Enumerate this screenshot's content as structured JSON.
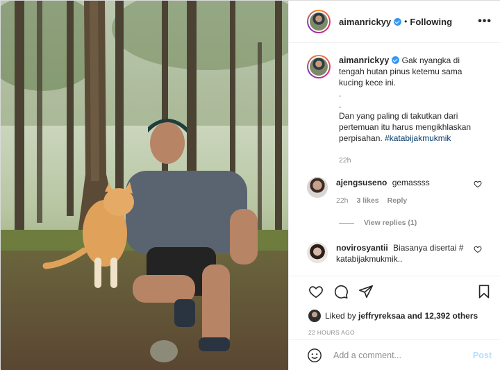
{
  "post": {
    "username": "aimanrickyy",
    "separator": "•",
    "follow_status": "Following",
    "more_label": "•••"
  },
  "caption": {
    "username": "aimanrickyy",
    "lines": [
      "Gak nyangka di",
      "tengah hutan pinus ketemu sama",
      "kucing kece ini.",
      ".",
      ".",
      "Dan yang paling di takutkan dari",
      "pertemuan itu harus mengikhlaskan",
      "perpisahan."
    ],
    "hashtag": "#katabijakmukmik",
    "time": "22h"
  },
  "comments": [
    {
      "username": "ajengsuseno",
      "text": "gemassss",
      "time": "22h",
      "likes": "3 likes",
      "reply": "Reply",
      "view_replies": "View replies (1)"
    },
    {
      "username": "novirosyantii",
      "text": "Biasanya disertai # katabijakmukmik.."
    }
  ],
  "likes": {
    "prefix": "Liked by",
    "user": "jeffryreksaa",
    "suffix": "and 12,392 others"
  },
  "timestamp": "22 HOURS AGO",
  "add_comment": {
    "placeholder": "Add a comment...",
    "post_label": "Post"
  },
  "icons": [
    "more-icon",
    "verified-icon",
    "heart-icon",
    "comment-icon",
    "share-icon",
    "bookmark-icon",
    "emoji-icon"
  ],
  "colors": {
    "verified": "#3897f0",
    "hashtag": "#00376b",
    "post_disabled": "#b2dffc",
    "muted": "#8e8e8e"
  }
}
